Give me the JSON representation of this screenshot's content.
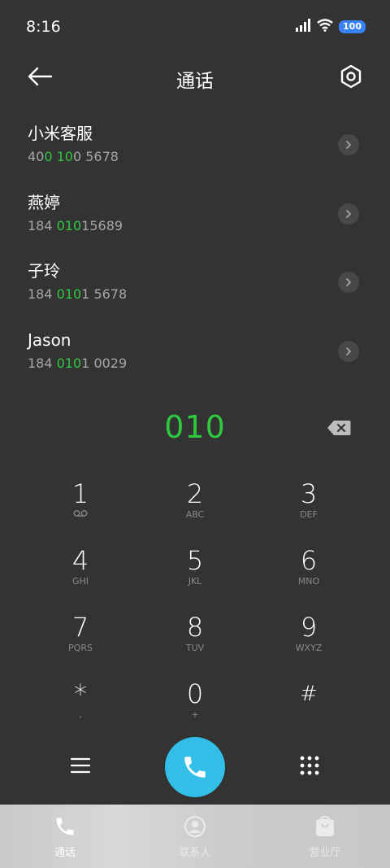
{
  "status_bar": {
    "time": "8:16",
    "battery": "100"
  },
  "header": {
    "title": "通话"
  },
  "contacts": [
    {
      "name": "小米客服",
      "number_parts": [
        "40",
        "0 10",
        "0 5678"
      ]
    },
    {
      "name": "燕婷",
      "number_parts": [
        "184 ",
        "010",
        "15689"
      ]
    },
    {
      "name": "子玲",
      "number_parts": [
        "184 ",
        "010",
        "1 5678"
      ]
    },
    {
      "name": "Jason",
      "number_parts": [
        "184 ",
        "010",
        "1 0029"
      ]
    }
  ],
  "dial": {
    "entered": "010"
  },
  "keypad": [
    {
      "digit": "1",
      "letters": ""
    },
    {
      "digit": "2",
      "letters": "ABC"
    },
    {
      "digit": "3",
      "letters": "DEF"
    },
    {
      "digit": "4",
      "letters": "GHI"
    },
    {
      "digit": "5",
      "letters": "JKL"
    },
    {
      "digit": "6",
      "letters": "MNO"
    },
    {
      "digit": "7",
      "letters": "PQRS"
    },
    {
      "digit": "8",
      "letters": "TUV"
    },
    {
      "digit": "9",
      "letters": "WXYZ"
    },
    {
      "digit": "*",
      "letters": ","
    },
    {
      "digit": "0",
      "letters": "+"
    },
    {
      "digit": "#",
      "letters": ""
    }
  ],
  "bottom_nav": [
    {
      "label": "通话",
      "icon": "phone-icon",
      "active": true
    },
    {
      "label": "联系人",
      "icon": "person-icon",
      "active": false
    },
    {
      "label": "营业厅",
      "icon": "shopping-bag-icon",
      "active": false
    }
  ],
  "colors": {
    "background": "#333333",
    "highlight": "#2fc93f",
    "call_button": "#33bfe8",
    "battery": "#3a82f7"
  }
}
